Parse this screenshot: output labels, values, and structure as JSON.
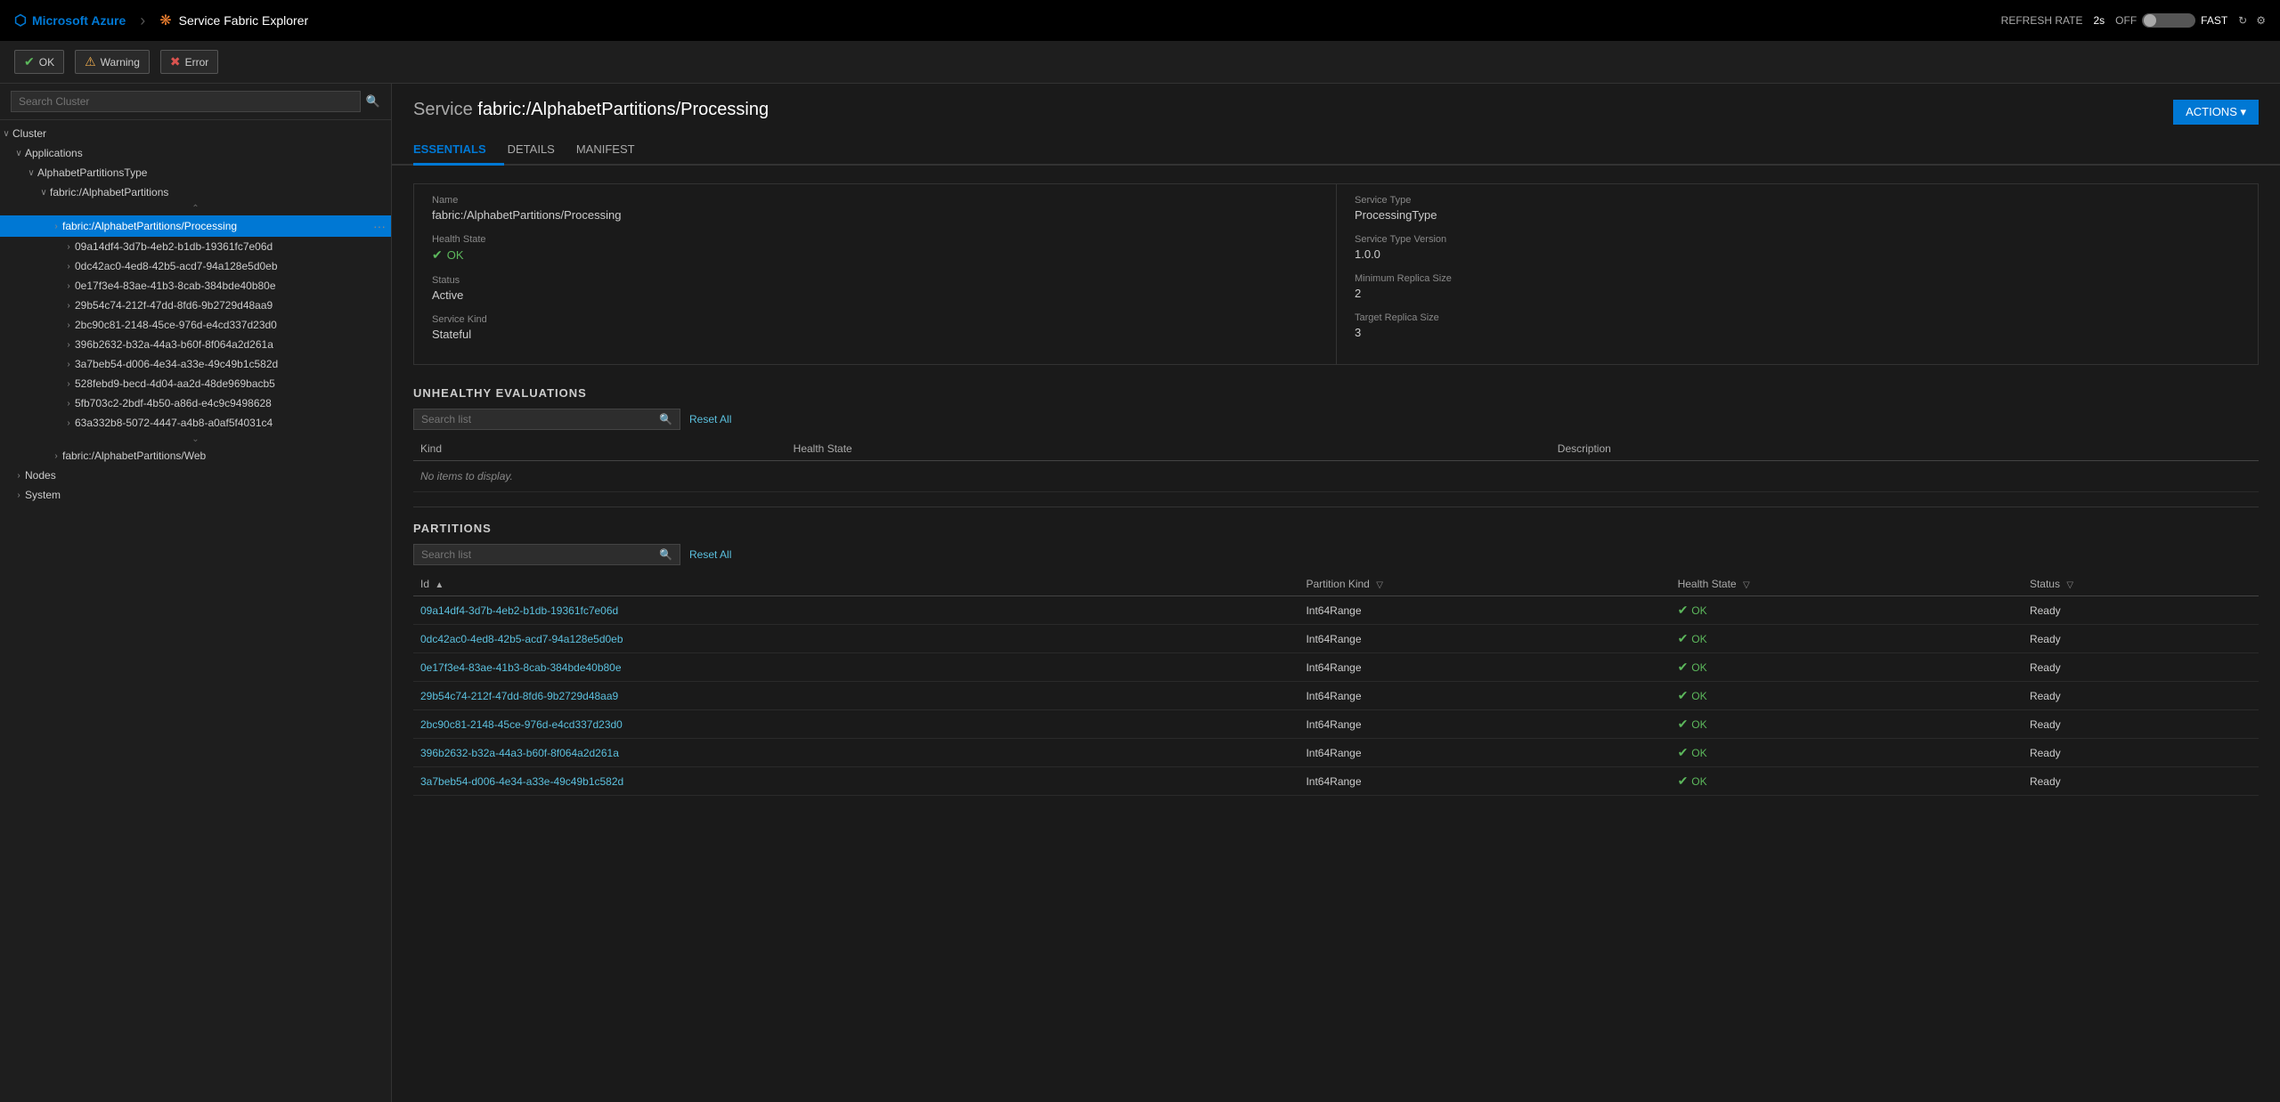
{
  "topNav": {
    "azureBrand": "Microsoft Azure",
    "appTitle": "Service Fabric Explorer",
    "refreshLabel": "REFRESH RATE",
    "refreshRate": "2s",
    "offLabel": "OFF",
    "fastLabel": "FAST"
  },
  "statusBar": {
    "okLabel": "OK",
    "warningLabel": "Warning",
    "errorLabel": "Error"
  },
  "sidebar": {
    "searchPlaceholder": "Search Cluster",
    "treeItems": [
      {
        "id": "cluster",
        "label": "Cluster",
        "level": 0,
        "expanded": true,
        "hasChevron": true,
        "active": false
      },
      {
        "id": "applications",
        "label": "Applications",
        "level": 1,
        "expanded": true,
        "hasChevron": true,
        "active": false
      },
      {
        "id": "alphabetPartitionsType",
        "label": "AlphabetPartitionsType",
        "level": 2,
        "expanded": true,
        "hasChevron": true,
        "active": false
      },
      {
        "id": "fabricAlphabetPartitions",
        "label": "fabric:/AlphabetPartitions",
        "level": 3,
        "expanded": true,
        "hasChevron": true,
        "active": false
      },
      {
        "id": "fabricAlphabetPartitionsProcessing",
        "label": "fabric:/AlphabetPartitions/Processing",
        "level": 4,
        "expanded": false,
        "hasChevron": true,
        "active": true
      },
      {
        "id": "partition1",
        "label": "09a14df4-3d7b-4eb2-b1db-19361fc7e06d",
        "level": 5,
        "expanded": false,
        "hasChevron": true,
        "active": false
      },
      {
        "id": "partition2",
        "label": "0dc42ac0-4ed8-42b5-acd7-94a128e5d0eb",
        "level": 5,
        "expanded": false,
        "hasChevron": true,
        "active": false
      },
      {
        "id": "partition3",
        "label": "0e17f3e4-83ae-41b3-8cab-384bde40b80e",
        "level": 5,
        "expanded": false,
        "hasChevron": true,
        "active": false
      },
      {
        "id": "partition4",
        "label": "29b54c74-212f-47dd-8fd6-9b2729d48aa9",
        "level": 5,
        "expanded": false,
        "hasChevron": true,
        "active": false
      },
      {
        "id": "partition5",
        "label": "2bc90c81-2148-45ce-976d-e4cd337d23d0",
        "level": 5,
        "expanded": false,
        "hasChevron": true,
        "active": false
      },
      {
        "id": "partition6",
        "label": "396b2632-b32a-44a3-b60f-8f064a2d261a",
        "level": 5,
        "expanded": false,
        "hasChevron": true,
        "active": false
      },
      {
        "id": "partition7",
        "label": "3a7beb54-d006-4e34-a33e-49c49b1c582d",
        "level": 5,
        "expanded": false,
        "hasChevron": true,
        "active": false
      },
      {
        "id": "partition8",
        "label": "528febd9-becd-4d04-aa2d-48de969bacb5",
        "level": 5,
        "expanded": false,
        "hasChevron": true,
        "active": false
      },
      {
        "id": "partition9",
        "label": "5fb703c2-2bdf-4b50-a86d-e4c9c9498628",
        "level": 5,
        "expanded": false,
        "hasChevron": true,
        "active": false
      },
      {
        "id": "partition10",
        "label": "63a332b8-5072-4447-a4b8-a0af5f4031c4",
        "level": 5,
        "expanded": false,
        "hasChevron": true,
        "active": false
      },
      {
        "id": "fabricAlphabetPartitionsWeb",
        "label": "fabric:/AlphabetPartitions/Web",
        "level": 4,
        "expanded": false,
        "hasChevron": true,
        "active": false
      },
      {
        "id": "nodes",
        "label": "Nodes",
        "level": 1,
        "expanded": false,
        "hasChevron": true,
        "active": false
      },
      {
        "id": "system",
        "label": "System",
        "level": 1,
        "expanded": false,
        "hasChevron": true,
        "active": false
      }
    ]
  },
  "service": {
    "titleLabel": "Service",
    "titleName": "fabric:/AlphabetPartitions/Processing",
    "actionsLabel": "ACTIONS ▾"
  },
  "tabs": [
    {
      "id": "essentials",
      "label": "ESSENTIALS",
      "active": true
    },
    {
      "id": "details",
      "label": "DETAILS",
      "active": false
    },
    {
      "id": "manifest",
      "label": "MANIFEST",
      "active": false
    }
  ],
  "essentials": {
    "left": {
      "nameLabel": "Name",
      "nameValue": "fabric:/AlphabetPartitions/Processing",
      "healthStateLabel": "Health State",
      "healthStateValue": "OK",
      "statusLabel": "Status",
      "statusValue": "Active",
      "serviceKindLabel": "Service Kind",
      "serviceKindValue": "Stateful"
    },
    "right": {
      "serviceTypeLabel": "Service Type",
      "serviceTypeValue": "ProcessingType",
      "serviceTypeVersionLabel": "Service Type Version",
      "serviceTypeVersionValue": "1.0.0",
      "minReplicaSizeLabel": "Minimum Replica Size",
      "minReplicaSizeValue": "2",
      "targetReplicaSizeLabel": "Target Replica Size",
      "targetReplicaSizeValue": "3"
    }
  },
  "unhealthyEvaluations": {
    "title": "UNHEALTHY EVALUATIONS",
    "searchPlaceholder": "Search list",
    "resetAllLabel": "Reset All",
    "columns": [
      {
        "label": "Kind"
      },
      {
        "label": "Health State"
      },
      {
        "label": "Description"
      }
    ],
    "noItemsText": "No items to display.",
    "items": []
  },
  "partitions": {
    "title": "PARTITIONS",
    "searchPlaceholder": "Search list",
    "resetAllLabel": "Reset All",
    "columns": [
      {
        "label": "Id",
        "sortable": true,
        "filterable": false
      },
      {
        "label": "Partition Kind",
        "sortable": false,
        "filterable": true
      },
      {
        "label": "Health State",
        "sortable": false,
        "filterable": true
      },
      {
        "label": "Status",
        "sortable": false,
        "filterable": true
      }
    ],
    "items": [
      {
        "id": "09a14df4-3d7b-4eb2-b1db-19361fc7e06d",
        "partitionKind": "Int64Range",
        "healthState": "OK",
        "status": "Ready"
      },
      {
        "id": "0dc42ac0-4ed8-42b5-acd7-94a128e5d0eb",
        "partitionKind": "Int64Range",
        "healthState": "OK",
        "status": "Ready"
      },
      {
        "id": "0e17f3e4-83ae-41b3-8cab-384bde40b80e",
        "partitionKind": "Int64Range",
        "healthState": "OK",
        "status": "Ready"
      },
      {
        "id": "29b54c74-212f-47dd-8fd6-9b2729d48aa9",
        "partitionKind": "Int64Range",
        "healthState": "OK",
        "status": "Ready"
      },
      {
        "id": "2bc90c81-2148-45ce-976d-e4cd337d23d0",
        "partitionKind": "Int64Range",
        "healthState": "OK",
        "status": "Ready"
      },
      {
        "id": "396b2632-b32a-44a3-b60f-8f064a2d261a",
        "partitionKind": "Int64Range",
        "healthState": "OK",
        "status": "Ready"
      },
      {
        "id": "3a7beb54-d006-4e34-a33e-49c49b1c582d",
        "partitionKind": "Int64Range",
        "healthState": "OK",
        "status": "Ready"
      }
    ]
  }
}
